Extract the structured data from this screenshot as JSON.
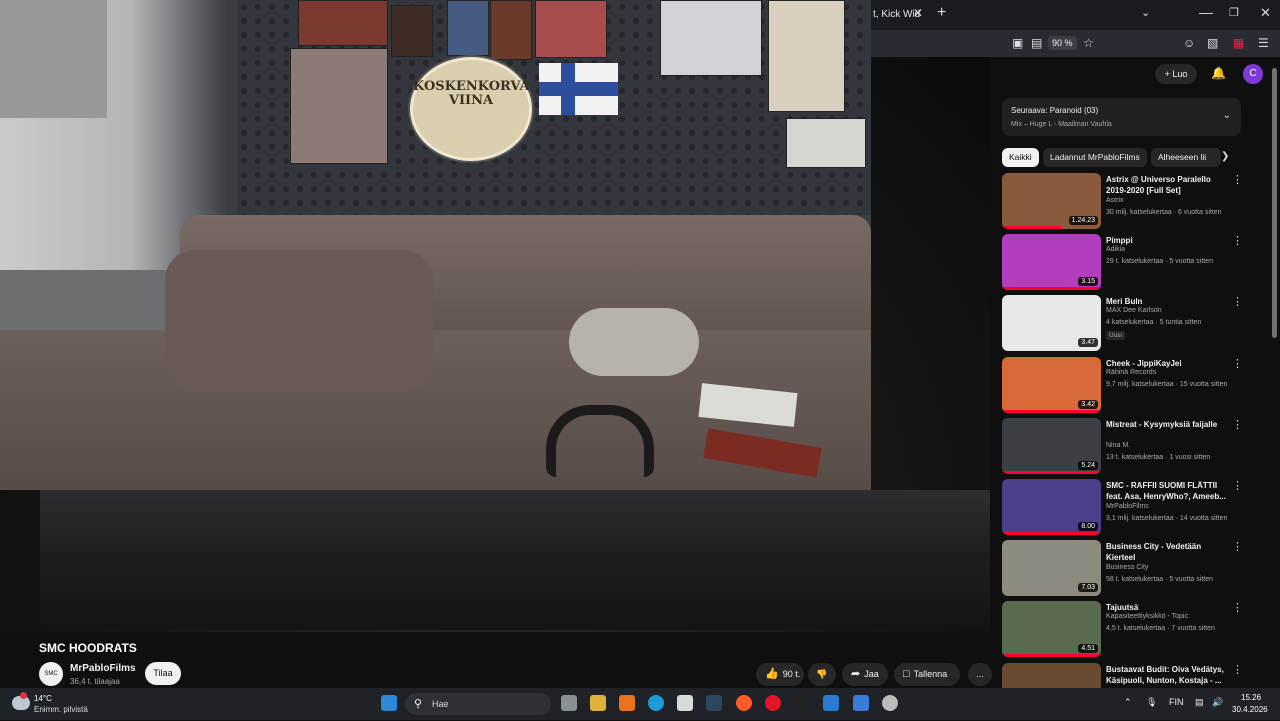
{
  "browser": {
    "tab_title": "t, Kick Wid",
    "tab_close": "✕",
    "new_tab": "+",
    "zoom": "90 %"
  },
  "overlay_sign": "KOSKENKORVA VIINA",
  "video": {
    "title": "SMC HOODRATS",
    "channel": "MrPabloFilms",
    "subscribers": "36,4 t. tilaajaa",
    "subscribe_label": "Tilaa",
    "likes": "90 t.",
    "share_label": "Jaa",
    "save_label": "Tallenna",
    "more_label": "..."
  },
  "masthead": {
    "create_label": "Luo",
    "avatar_letter": "C"
  },
  "playlist": {
    "next_label": "Seuraava: Paranoid (03)",
    "subtitle": "Mix – Huge L - Maailman Vauhla"
  },
  "chips": [
    "Kaikki",
    "Ladannut MrPabloFilms",
    "Alheeseen lii"
  ],
  "recommendations": [
    {
      "title": "Astrix @ Universo Paralello 2019-2020 [Full Set]",
      "channel": "Astrix",
      "meta": "30 milj. katselukertaa · 6 vuotta sitten",
      "duration": "1.24.23",
      "progress": 0.6
    },
    {
      "title": "Pimppi",
      "channel": "Adikia",
      "meta": "29 t. katselukertaa · 5 vuotta sitten",
      "duration": "3.15",
      "progress": 1.0
    },
    {
      "title": "Meri Buln",
      "channel": "MAX Dee Karlson",
      "meta": "4 katselukertaa · 5 tuntia sitten",
      "duration": "3.47",
      "badge": "Uusi",
      "progress": 0
    },
    {
      "title": "Cheek - JippiKayJei",
      "channel": "Rähinä Records",
      "meta": "9,7 milj. katselukertaa · 15 vuotta sitten",
      "duration": "3.42",
      "progress": 1.0
    },
    {
      "title": "Mistreat - Kysymyksiä faijalle",
      "channel": "Nina M.",
      "meta": "13 t. katselukertaa · 1 vuosi sitten",
      "duration": "5.24",
      "progress": 1.0
    },
    {
      "title": "SMC - RAFFII SUOMI FLÄTTII feat. Asa, HenryWho?, Ameeb...",
      "channel": "MrPabloFilms",
      "meta": "3,1 milj. katselukertaa · 14 vuotta sitten",
      "duration": "8.00",
      "progress": 1.0
    },
    {
      "title": "Business City - Vedetään Kierteel",
      "channel": "Business City",
      "meta": "58 t. katselukertaa · 5 vuotta sitten",
      "duration": "7.03",
      "progress": 0
    },
    {
      "title": "Tajuutsä",
      "channel": "Kapasiteettiyksikkö - Topic",
      "meta": "4,5 t. katselukertaa · 7 vuotta sitten",
      "duration": "4.51",
      "progress": 1.0
    },
    {
      "title": "Bustaavat Budit: Oiva Vedätys, Käsipuoli, Nunton, Kostaja - ...",
      "channel": "",
      "meta": "",
      "duration": "",
      "progress": 0
    }
  ],
  "taskbar": {
    "temperature": "14°C",
    "condition": "Enimm. pilvistä",
    "search_placeholder": "Hae",
    "language": "FIN",
    "time": "15.26",
    "date": "30.4.2026"
  }
}
